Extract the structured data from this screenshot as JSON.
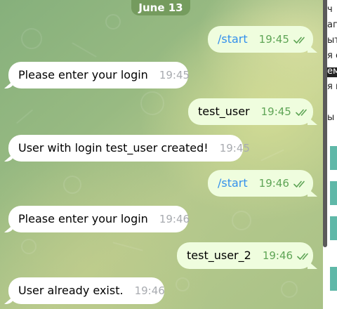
{
  "chat": {
    "date_label": "June 13",
    "messages": [
      {
        "direction": "outgoing",
        "text": "/start",
        "time": "19:45",
        "is_command": true
      },
      {
        "direction": "incoming",
        "text": "Please enter your login",
        "time": "19:45"
      },
      {
        "direction": "outgoing",
        "text": "test_user",
        "time": "19:45",
        "is_command": false
      },
      {
        "direction": "incoming",
        "text": "User with login test_user created!",
        "time": "19:45"
      },
      {
        "direction": "outgoing",
        "text": "/start",
        "time": "19:46",
        "is_command": true
      },
      {
        "direction": "incoming",
        "text": "Please enter your login",
        "time": "19:46"
      },
      {
        "direction": "outgoing",
        "text": "test_user_2",
        "time": "19:46",
        "is_command": false
      },
      {
        "direction": "incoming",
        "text": "User already exist.",
        "time": "19:46"
      }
    ]
  },
  "side_panel": {
    "fragments": [
      "ч",
      "апп",
      "ыт",
      "я с",
      "ем",
      "я п",
      "ы"
    ]
  },
  "colors": {
    "incoming_bubble": "#ffffff",
    "outgoing_bubble": "#effdde",
    "command_link": "#3390ec",
    "read_check": "#5fa556",
    "date_chip": "#709658"
  },
  "icons": {
    "read_status": "double-check-icon"
  }
}
